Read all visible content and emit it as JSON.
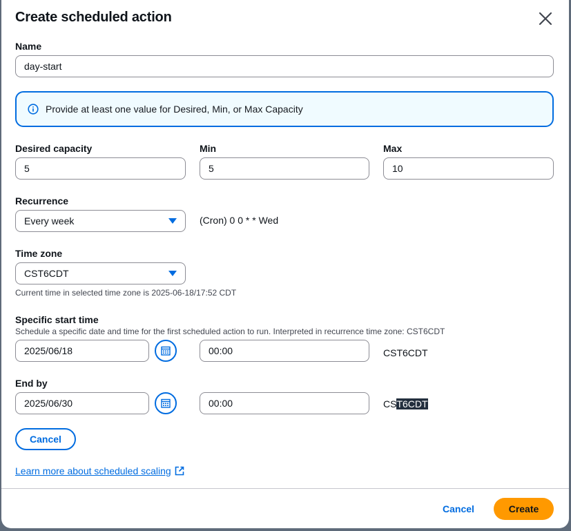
{
  "modal": {
    "title": "Create scheduled action"
  },
  "name": {
    "label": "Name",
    "value": "day-start"
  },
  "alert": {
    "text": "Provide at least one value for Desired, Min, or Max Capacity"
  },
  "capacity": {
    "desired_label": "Desired capacity",
    "desired_value": "5",
    "min_label": "Min",
    "min_value": "5",
    "max_label": "Max",
    "max_value": "10"
  },
  "recurrence": {
    "label": "Recurrence",
    "value": "Every week",
    "cron": "(Cron) 0 0 * * Wed"
  },
  "timezone": {
    "label": "Time zone",
    "value": "CST6CDT",
    "hint": "Current time in selected time zone is 2025-06-18/17:52 CDT"
  },
  "start": {
    "label": "Specific start time",
    "description": "Schedule a specific date and time for the first scheduled action to run. Interpreted in recurrence time zone: CST6CDT",
    "date": "2025/06/18",
    "time": "00:00",
    "tz": "CST6CDT"
  },
  "end": {
    "label": "End by",
    "date": "2025/06/30",
    "time": "00:00",
    "tz_plain": "CS",
    "tz_selected": "T6CDT"
  },
  "inline_cancel": "Cancel",
  "learn_more": "Learn more about scheduled scaling",
  "footer": {
    "cancel": "Cancel",
    "create": "Create"
  },
  "colors": {
    "accent": "#006ce0",
    "primary": "#ff9900",
    "alert_bg": "#f0fbff"
  },
  "icons": [
    "close-icon",
    "info-icon",
    "caret-down-icon",
    "calendar-icon",
    "external-link-icon"
  ]
}
